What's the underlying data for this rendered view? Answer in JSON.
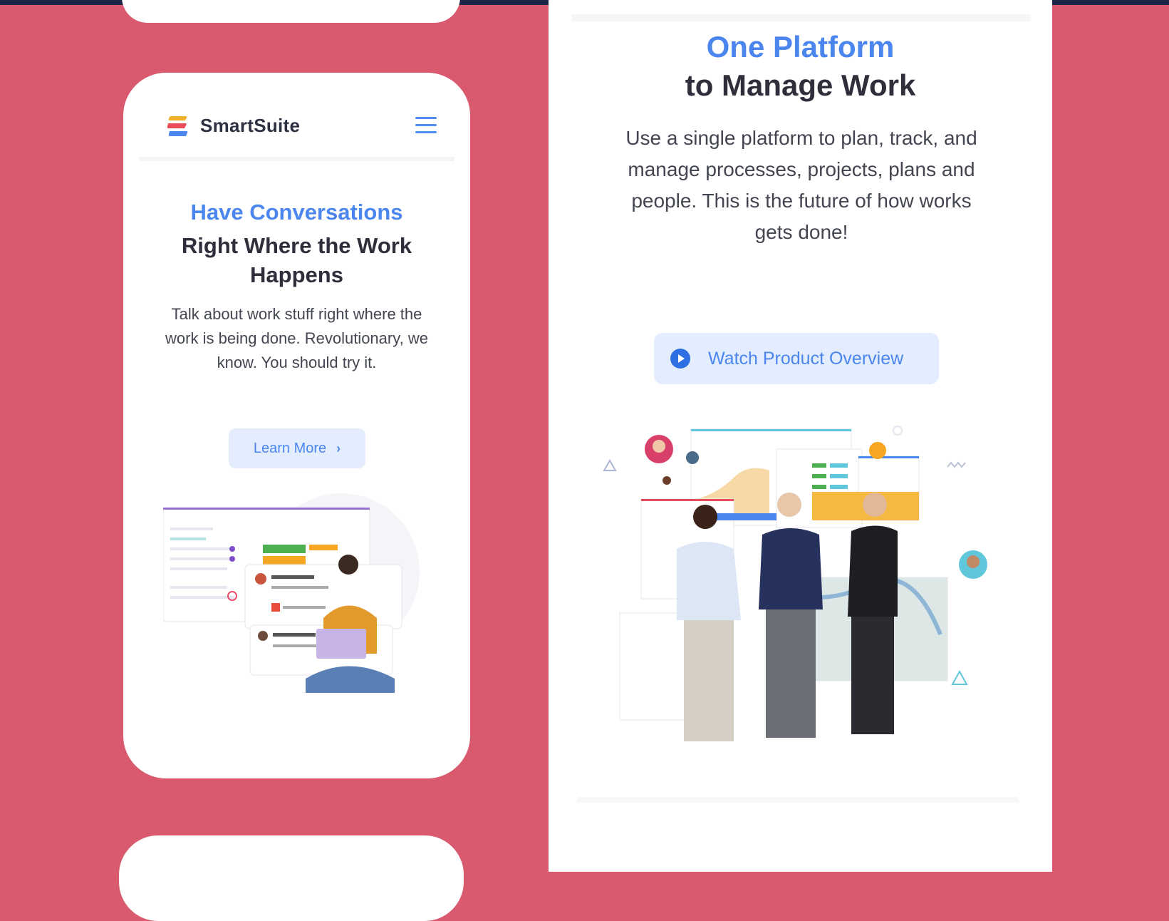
{
  "colors": {
    "background": "#d95a6e",
    "topbar": "#1f2549",
    "accent_blue": "#4a86ee",
    "heading_dark": "#2e2f3a",
    "button_bg": "#e3edfd"
  },
  "phone": {
    "brand_name": "SmartSuite",
    "menu_icon": "hamburger-icon",
    "title_blue": "Have Conversations",
    "title_dark": "Right Where the Work Happens",
    "description": "Talk about work stuff right where the work is being done. Revolutionary, we know. You should try it.",
    "learn_more_label": "Learn More",
    "learn_more_icon": "chevron-right-icon"
  },
  "panel": {
    "title_blue": "One Platform",
    "title_dark": "to Manage Work",
    "description": "Use a single platform to plan, track, and manage processes, projects, plans and people.  This is the future of how works gets done!",
    "watch_label": "Watch Product Overview",
    "watch_icon": "play-circle-icon"
  }
}
